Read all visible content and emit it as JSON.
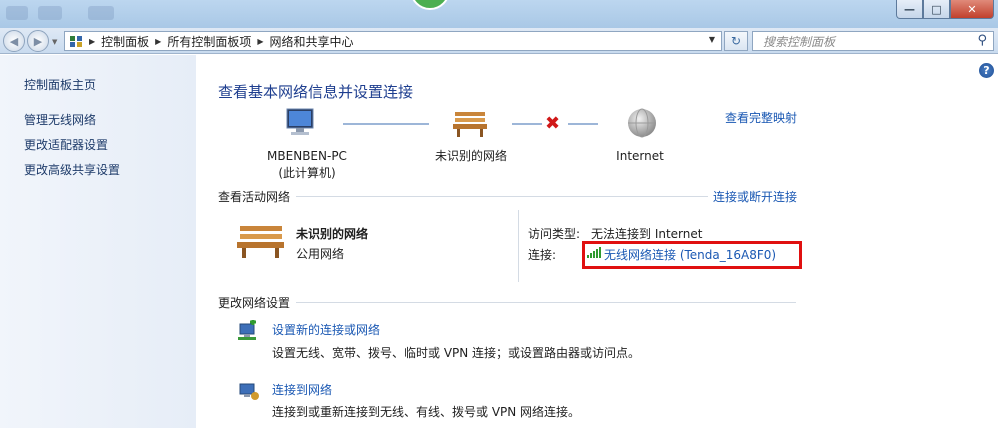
{
  "window": {
    "controls": {
      "minimize": "—",
      "maximize": "□",
      "close": "✕"
    }
  },
  "address": {
    "crumbs": [
      "控制面板",
      "所有控制面板项",
      "网络和共享中心"
    ],
    "search_placeholder": "搜索控制面板"
  },
  "sidebar": {
    "items": [
      {
        "label": "控制面板主页"
      },
      {
        "label": "管理无线网络"
      },
      {
        "label": "更改适配器设置"
      },
      {
        "label": "更改高级共享设置"
      }
    ]
  },
  "main": {
    "title": "查看基本网络信息并设置连接",
    "full_map_link": "查看完整映射",
    "map": {
      "computer_name": "MBENBEN-PC",
      "computer_sub": "(此计算机)",
      "network_label": "未识别的网络",
      "internet_label": "Internet"
    },
    "active": {
      "section_label": "查看活动网络",
      "connect_link": "连接或断开连接",
      "network_name": "未识别的网络",
      "network_type": "公用网络",
      "access_type_label": "访问类型:",
      "access_type_value": "无法连接到 Internet",
      "connection_label": "连接:",
      "connection_value": "无线网络连接 (Tenda_16A8F0)"
    },
    "change": {
      "section_label": "更改网络设置",
      "tasks": [
        {
          "title": "设置新的连接或网络",
          "desc": "设置无线、宽带、拨号、临时或 VPN 连接；或设置路由器或访问点。"
        },
        {
          "title": "连接到网络",
          "desc": "连接到或重新连接到无线、有线、拨号或 VPN 网络连接。"
        }
      ]
    }
  },
  "colors": {
    "highlight": "#e01010",
    "link": "#1a58b3",
    "title": "#1e3e8f"
  }
}
